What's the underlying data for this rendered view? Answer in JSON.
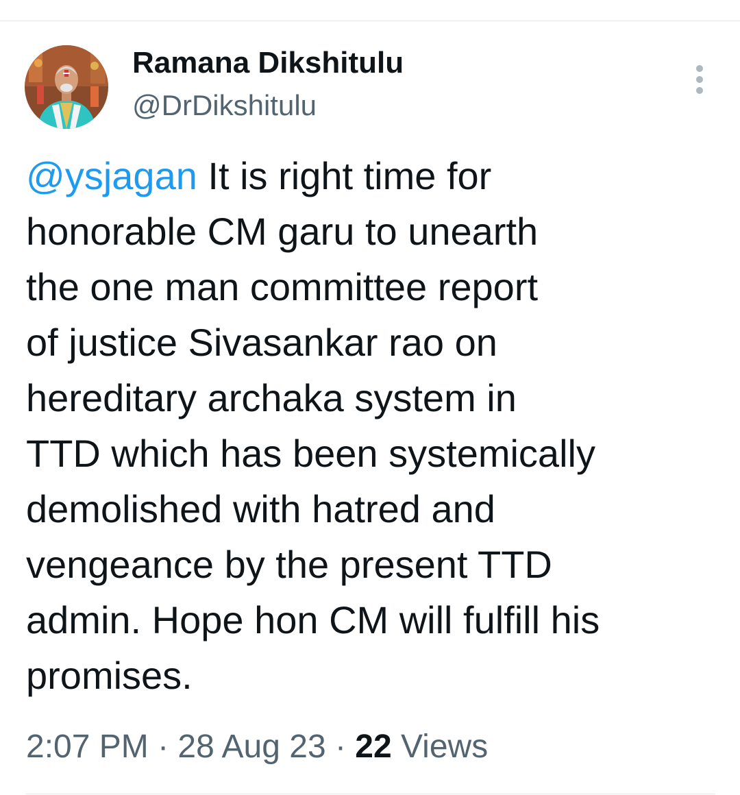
{
  "author": {
    "display_name": "Ramana Dikshitulu",
    "handle": "@DrDikshitulu"
  },
  "tweet": {
    "mention": "@ysjagan",
    "first_line_rest": " It is right time for",
    "lines": [
      "honorable CM garu to unearth",
      "the one man committee report",
      "of justice Sivasankar rao on",
      "hereditary archaka system in",
      "TTD which has been systemically",
      "demolished with hatred and",
      "vengeance by the present TTD",
      "admin. Hope hon CM will fulfill his",
      "promises."
    ]
  },
  "meta": {
    "time": "2:07 PM",
    "separator": " · ",
    "date": "28 Aug 23",
    "views_count": "22",
    "views_label": " Views"
  },
  "icons": {
    "more": "more-vertical-icon"
  },
  "colors": {
    "mention": "#1d9bf0",
    "secondary_text": "#536471",
    "primary_text": "#0f1419"
  }
}
